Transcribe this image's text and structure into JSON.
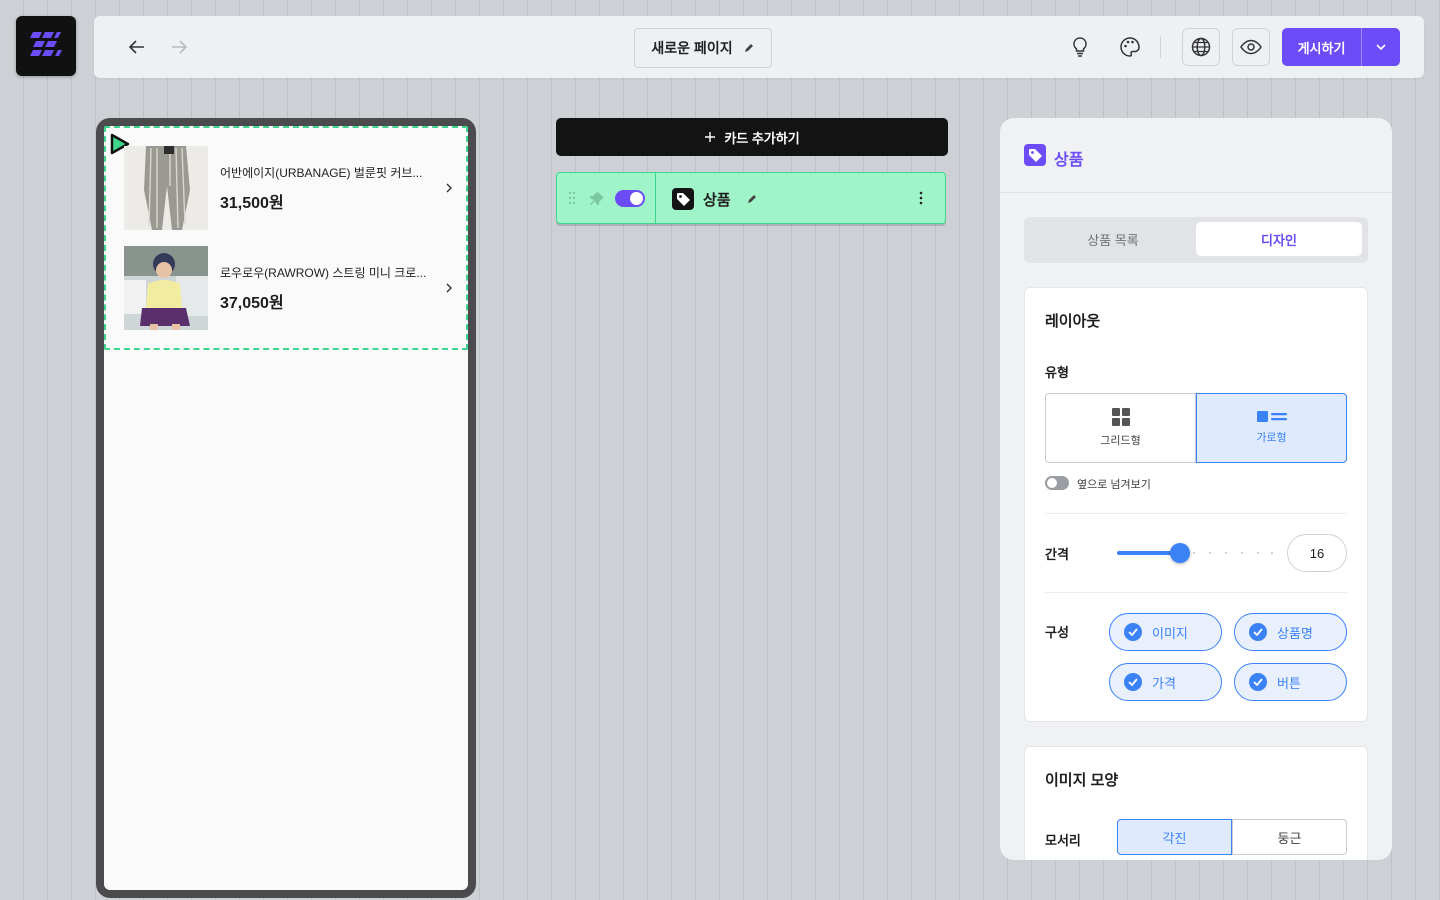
{
  "header": {
    "page_title": "새로운 페이지",
    "publish_label": "게시하기"
  },
  "preview": {
    "products": [
      {
        "name": "어반에이지(URBANAGE) 벌룬핏 커브...",
        "price": "31,500원"
      },
      {
        "name": "로우로우(RAWROW) 스트링 미니 크로...",
        "price": "37,050원"
      }
    ]
  },
  "editor": {
    "add_card_label": "카드 추가하기",
    "block_title": "상품",
    "block_visible": true
  },
  "panel": {
    "title": "상품",
    "tabs": [
      {
        "label": "상품 목록",
        "active": false
      },
      {
        "label": "디자인",
        "active": true
      }
    ],
    "layout": {
      "title": "레이아웃",
      "type_label": "유형",
      "type_options": [
        {
          "label": "그리드형",
          "active": false
        },
        {
          "label": "가로형",
          "active": true
        }
      ],
      "swipe_label": "옆으로 넘겨보기",
      "swipe_enabled": false,
      "gap_label": "간격",
      "gap_value": "16",
      "gap_slider_fraction": 0.4,
      "composition_label": "구성",
      "composition_items": [
        {
          "label": "이미지",
          "checked": true
        },
        {
          "label": "상품명",
          "checked": true
        },
        {
          "label": "가격",
          "checked": true
        },
        {
          "label": "버튼",
          "checked": true
        }
      ]
    },
    "image_shape": {
      "title": "이미지 모양",
      "corner_label": "모서리",
      "corner_options": [
        {
          "label": "각진",
          "active": true
        },
        {
          "label": "둥근",
          "active": false
        }
      ]
    }
  },
  "colors": {
    "accent_purple": "#6b4cf6",
    "accent_blue": "#3b82f6",
    "block_green": "#9ff5c8",
    "selection_green": "#3ed68f"
  }
}
